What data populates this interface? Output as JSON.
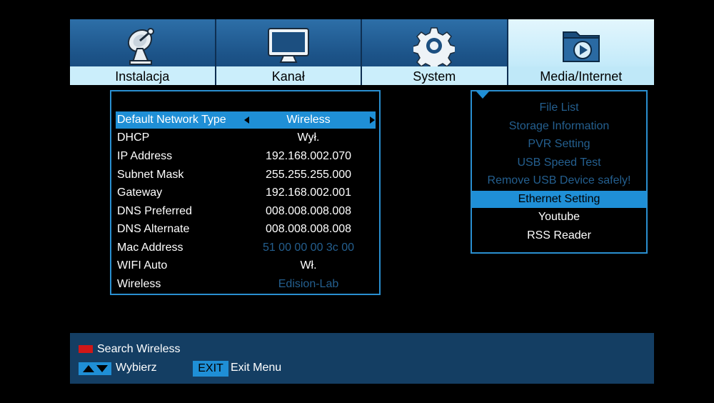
{
  "tabs": [
    {
      "label": "Instalacja",
      "icon": "satellite-dish-icon"
    },
    {
      "label": "Kanał",
      "icon": "tv-icon"
    },
    {
      "label": "System",
      "icon": "gear-icon"
    },
    {
      "label": "Media/Internet",
      "icon": "media-folder-icon",
      "active": true
    }
  ],
  "network": {
    "rows": [
      {
        "label": "Default Network Type",
        "value": "Wireless"
      },
      {
        "label": "DHCP",
        "value": "Wył."
      },
      {
        "label": "IP Address",
        "value": "192.168.002.070"
      },
      {
        "label": "Subnet Mask",
        "value": "255.255.255.000"
      },
      {
        "label": "Gateway",
        "value": "192.168.002.001"
      },
      {
        "label": "DNS Preferred",
        "value": "008.008.008.008"
      },
      {
        "label": "DNS Alternate",
        "value": "008.008.008.008"
      },
      {
        "label": "Mac Address",
        "value": "51 00 00 00 3c 00"
      },
      {
        "label": "WIFI Auto",
        "value": "Wł."
      },
      {
        "label": "Wireless",
        "value": "Edision-Lab"
      }
    ]
  },
  "menu": {
    "items": [
      "File List",
      "Storage Information",
      "PVR Setting",
      "USB Speed Test",
      "Remove USB Device safely!",
      "Ethernet Setting",
      "Youtube",
      "RSS Reader"
    ]
  },
  "bottom": {
    "search": "Search Wireless",
    "select": "Wybierz",
    "exit_key": "EXIT",
    "exit": "Exit Menu"
  },
  "colors": {
    "accent": "#1f8fd6",
    "dim_text": "#245f8f",
    "tab_label_bg": "#cbeefb",
    "bottom_bar": "#143e63"
  }
}
